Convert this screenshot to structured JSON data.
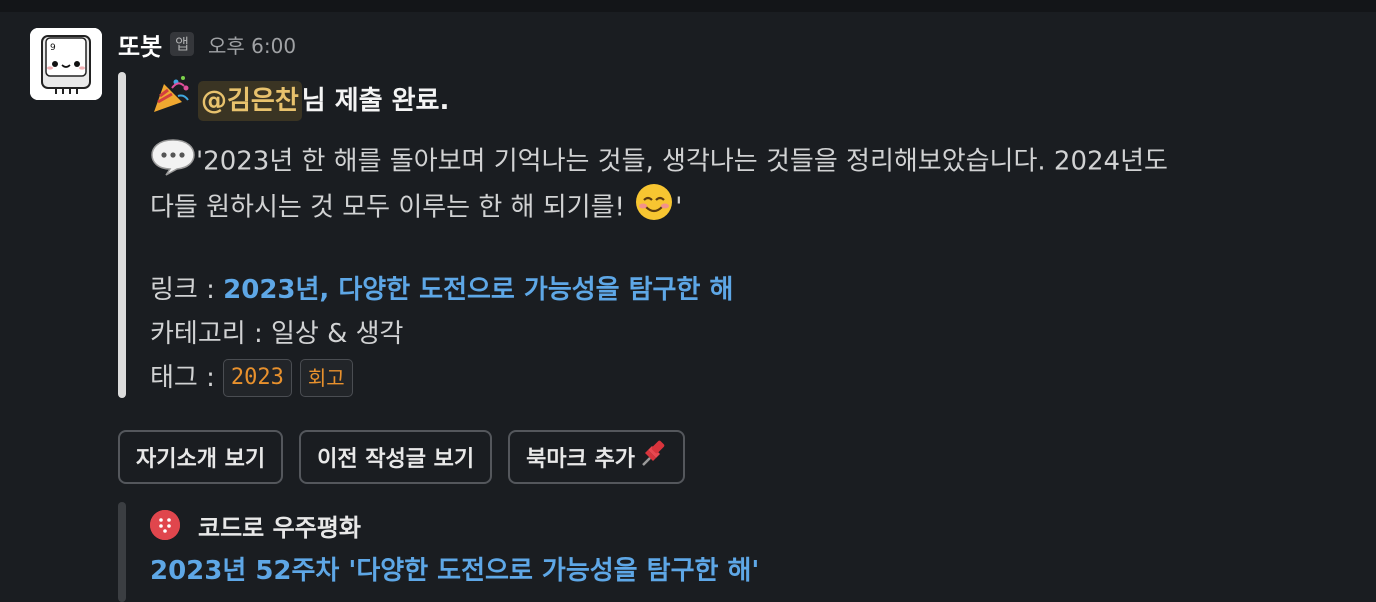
{
  "message": {
    "sender": "또봇",
    "app_badge": "앱",
    "timestamp": "오후 6:00"
  },
  "attachment": {
    "mention": "@김은찬",
    "title_suffix": "님 제출 완료.",
    "quote_line1": "'2023년 한 해를 돌아보며 기억나는 것들, 생각나는 것들을 정리해보았습니다. 2024년도",
    "quote_line2": "다들 원하시는 것 모두 이루는 한 해 되기를! ",
    "quote_end": "'",
    "link_label": "링크 : ",
    "link_text": "2023년, 다양한 도전으로 가능성을 탐구한 해",
    "category_label": "카테고리 : ",
    "category_value": "일상 & 생각",
    "tags_label": "태그 : ",
    "tags": [
      "2023",
      "회고"
    ]
  },
  "buttons": {
    "intro": "자기소개 보기",
    "previous": "이전 작성글 보기",
    "bookmark": "북마크 추가"
  },
  "unfurl": {
    "source_name": "코드로 우주평화",
    "title": "2023년 52주차 '다양한 도전으로 가능성을 탐구한 해'"
  },
  "colors": {
    "background": "#1a1d21",
    "link": "#5ea7e6",
    "mention": "#e8c26d",
    "tag": "#e8912d",
    "unfurl_icon": "#e0464d"
  },
  "icons": [
    "bot-avatar-icon",
    "party-popper-icon",
    "speech-bubble-icon",
    "smiling-face-icon",
    "pushpin-icon",
    "source-favicon-icon"
  ]
}
